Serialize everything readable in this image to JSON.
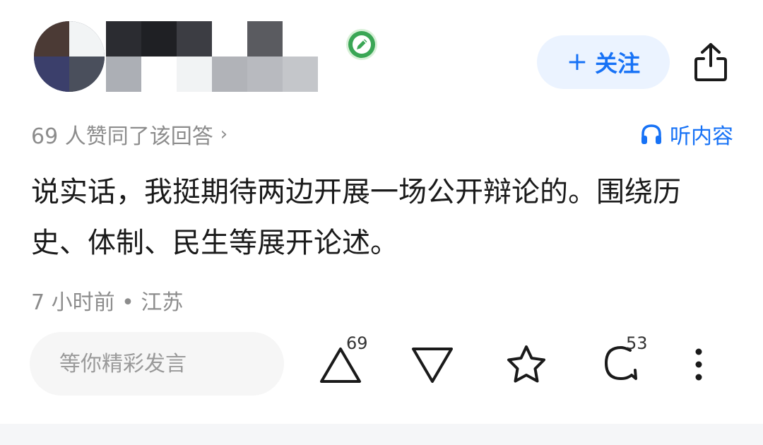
{
  "author": {
    "name": "",
    "bio": ""
  },
  "follow_button": {
    "plus": "+",
    "label": "关注"
  },
  "votes_summary": {
    "text": "69 人赞同了该回答",
    "chevron": "›"
  },
  "listen_button": {
    "label": "听内容",
    "icon": "headphones-icon"
  },
  "answer": {
    "text": "说实话，我挺期待两边开展一场公开辩论的。围绕历史、体制、民生等展开论述。"
  },
  "meta": {
    "text": "7 小时前 • 江苏"
  },
  "comment_box": {
    "placeholder": "等你精彩发言"
  },
  "actions": {
    "upvote_count": "69",
    "comment_count": "53"
  },
  "colors": {
    "accent": "#1772f6",
    "accent_bg": "#ebf3ff",
    "muted_text": "#8c8c8c",
    "body_text": "#1a1a1a",
    "input_bg": "#f6f6f6",
    "badge_green": "#3aa655"
  },
  "icons": [
    "share-icon",
    "headphones-icon",
    "upvote-triangle-icon",
    "downvote-triangle-icon",
    "star-icon",
    "comment-bubble-icon",
    "more-dots-icon",
    "pencil-badge-icon"
  ]
}
